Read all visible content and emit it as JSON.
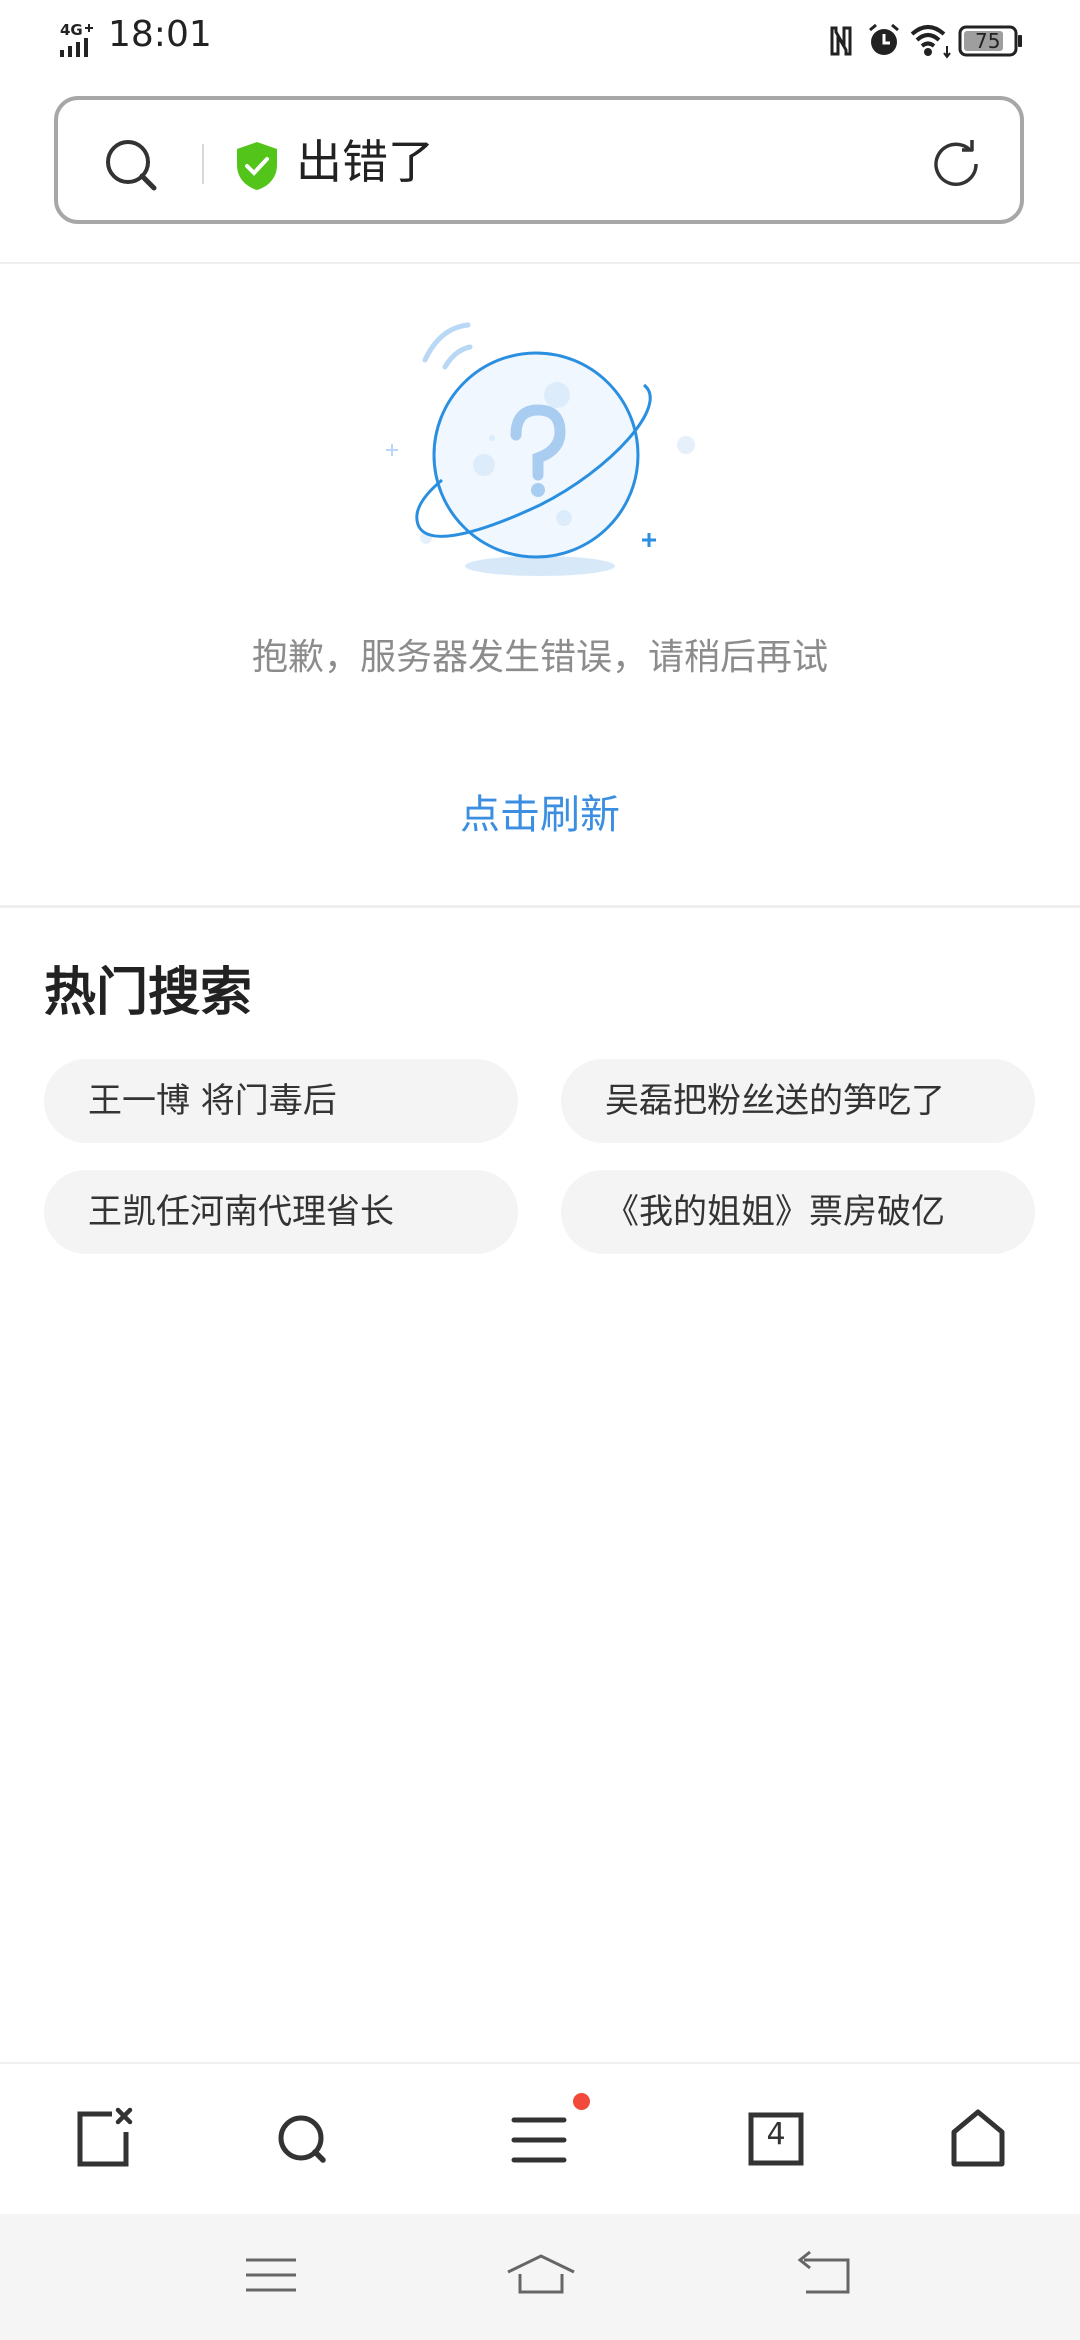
{
  "status_bar": {
    "network": "4G",
    "time": "18:01",
    "battery": "75",
    "icons": [
      "signal-icon",
      "nfc-icon",
      "alarm-icon",
      "wifi-icon",
      "battery-icon"
    ]
  },
  "address_bar": {
    "title": "出错了",
    "icons": [
      "search-icon",
      "shield-check-icon",
      "reload-icon"
    ],
    "shield_color": "#52c41a"
  },
  "error": {
    "message": "抱歉，服务器发生错误，请稍后再试",
    "refresh_label": "点击刷新",
    "accent_color": "#3b8ee0"
  },
  "hot_search": {
    "title": "热门搜索",
    "items": [
      "王一博  将门毒后",
      "吴磊把粉丝送的笋吃了",
      "王凯任河南代理省长",
      "《我的姐姐》票房破亿"
    ]
  },
  "toolbar": {
    "tab_count": "4",
    "icons": [
      "close-page-icon",
      "search-icon",
      "menu-icon",
      "tabs-icon",
      "home-icon"
    ]
  },
  "system_nav": {
    "icons": [
      "menu-icon",
      "home-icon",
      "back-icon"
    ]
  }
}
